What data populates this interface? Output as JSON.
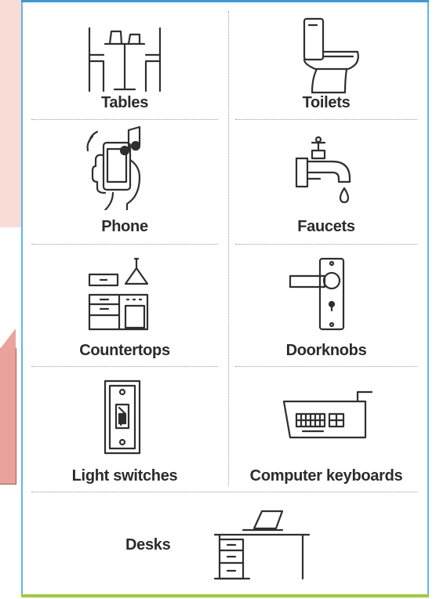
{
  "items": [
    {
      "label": "Tables",
      "icon": "table-chairs-icon"
    },
    {
      "label": "Toilets",
      "icon": "toilet-icon"
    },
    {
      "label": "Phone",
      "icon": "phone-hand-icon"
    },
    {
      "label": "Faucets",
      "icon": "faucet-icon"
    },
    {
      "label": "Countertops",
      "icon": "countertop-icon"
    },
    {
      "label": "Doorknobs",
      "icon": "doorknob-icon"
    },
    {
      "label": "Light switches",
      "icon": "light-switch-icon"
    },
    {
      "label": "Computer keyboards",
      "icon": "keyboard-icon"
    },
    {
      "label": "Desks",
      "icon": "desk-laptop-icon"
    }
  ],
  "colors": {
    "frame_border": "#5cb8e6",
    "frame_top": "#3b9ad3",
    "frame_bottom": "#9ccc3a",
    "left_panel": "#fadcd6",
    "left_arrow": "#e8a39a"
  }
}
